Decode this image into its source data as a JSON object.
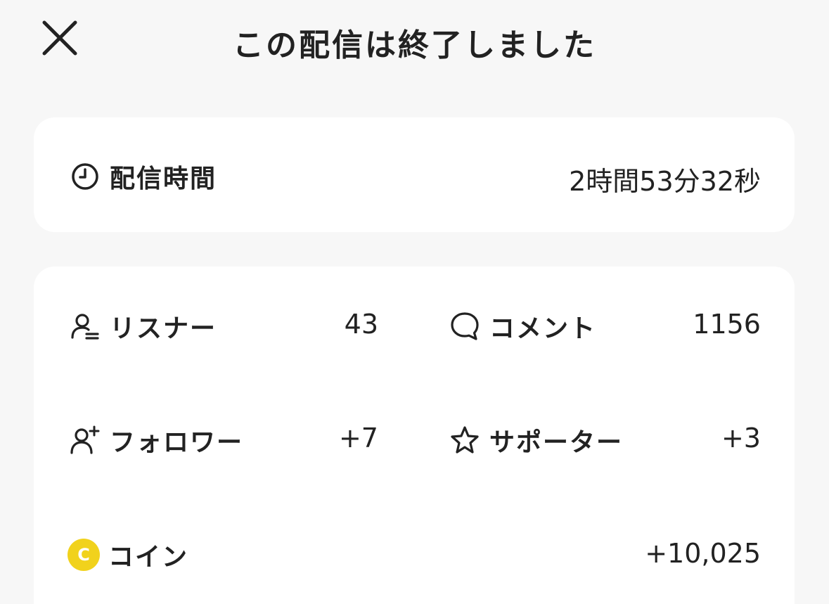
{
  "header": {
    "title": "この配信は終了しました",
    "close_icon": "close-icon"
  },
  "duration": {
    "label": "配信時間",
    "value": "2時間53分32秒",
    "icon": "clock-icon"
  },
  "stats": {
    "listeners": {
      "label": "リスナー",
      "value": "43",
      "icon": "listener-icon"
    },
    "comments": {
      "label": "コメント",
      "value": "1156",
      "icon": "comment-bubble-icon"
    },
    "followers": {
      "label": "フォロワー",
      "value": "+7",
      "icon": "add-user-icon"
    },
    "supporters": {
      "label": "サポーター",
      "value": "+3",
      "icon": "star-icon"
    },
    "coins": {
      "label": "コイン",
      "value": "+10,025",
      "icon": "coin-icon",
      "icon_text": "C",
      "icon_color": "#f1d21c"
    }
  }
}
